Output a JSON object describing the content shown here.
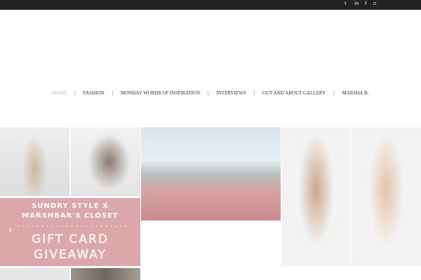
{
  "social": [
    {
      "icon": "twitter-icon",
      "glyph": "t"
    },
    {
      "icon": "linkedin-icon",
      "glyph": "in"
    },
    {
      "icon": "facebook-icon",
      "glyph": "f"
    },
    {
      "icon": "instagram-icon",
      "glyph": "◘"
    }
  ],
  "nav": [
    "HOME",
    "FASHION",
    "MONDAY WORDS OF INSPIRATION",
    "INTERVIEWS",
    "OUT AND ABOUT GALLERY",
    "MARSHA B."
  ],
  "separator": "|",
  "promo": {
    "line1": "SUNDRY STYLE X",
    "line2": "MARSHBAR'S CLOSET",
    "line3": "GIFT CARD",
    "line4": "GIVEAWAY",
    "prev_arrow": "‹"
  },
  "colors": {
    "topbar": "#222222",
    "promo_bg": "#dba7ab"
  }
}
